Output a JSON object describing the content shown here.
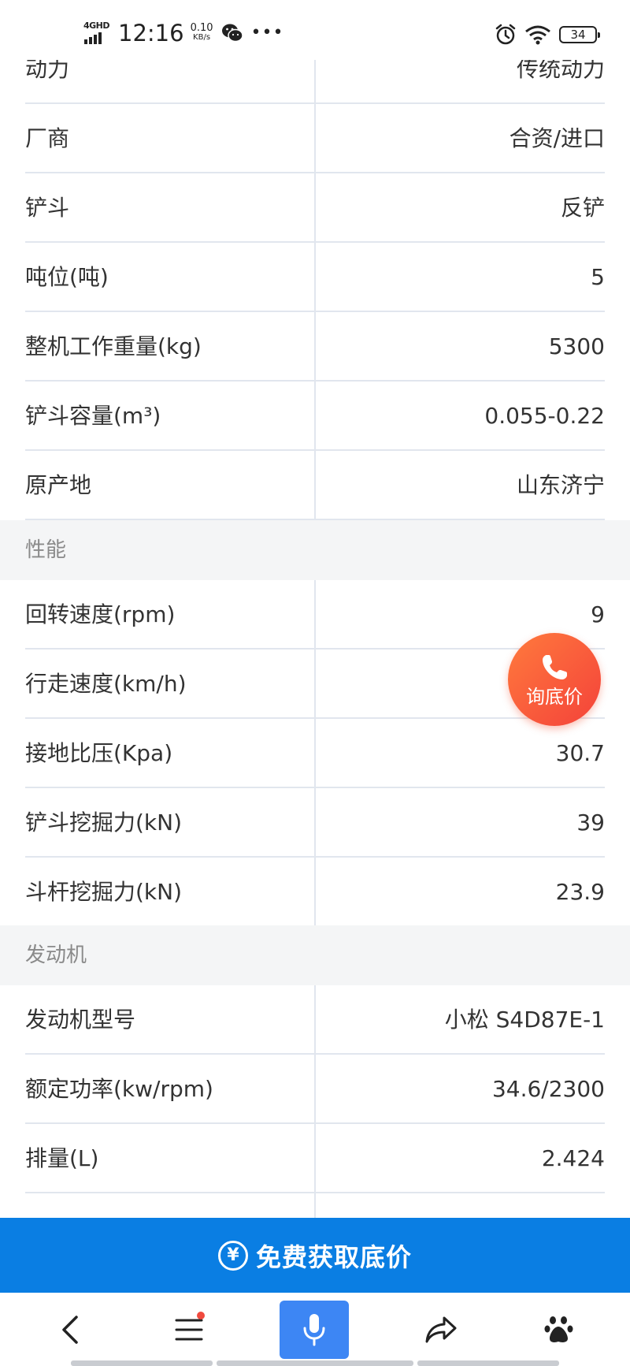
{
  "status_bar": {
    "network": "4GHD",
    "time": "12:16",
    "speed_value": "0.10",
    "speed_unit": "KB/s",
    "more": "•••",
    "battery": "34",
    "icons": [
      "wechat-icon",
      "alarm-icon",
      "wifi-icon",
      "battery-icon"
    ]
  },
  "specs": {
    "rows_group1": [
      {
        "label": "动力",
        "value": "传统动力"
      },
      {
        "label": "厂商",
        "value": "合资/进口"
      },
      {
        "label": "铲斗",
        "value": "反铲"
      },
      {
        "label": "吨位(吨)",
        "value": "5"
      },
      {
        "label": "整机工作重量(kg)",
        "value": "5300"
      },
      {
        "label": "铲斗容量(m³)",
        "value": "0.055-0.22"
      },
      {
        "label": "原产地",
        "value": "山东济宁"
      }
    ],
    "section_performance": "性能",
    "rows_group2": [
      {
        "label": "回转速度(rpm)",
        "value": "9"
      },
      {
        "label": "行走速度(km/h)",
        "value": ""
      },
      {
        "label": "接地比压(Kpa)",
        "value": "30.7"
      },
      {
        "label": "铲斗挖掘力(kN)",
        "value": "39"
      },
      {
        "label": "斗杆挖掘力(kN)",
        "value": "23.9"
      }
    ],
    "section_engine": "发动机",
    "rows_group3": [
      {
        "label": "发动机型号",
        "value": "小松 S4D87E-1"
      },
      {
        "label": "额定功率(kw/rpm)",
        "value": "34.6/2300"
      },
      {
        "label": "排量(L)",
        "value": "2.424"
      }
    ]
  },
  "fab": {
    "label": "询底价",
    "icon": "phone-icon"
  },
  "cta": {
    "label": "免费获取底价",
    "icon_glyph": "¥"
  },
  "nav": {
    "icons": [
      "back-icon",
      "menu-icon",
      "mic-icon",
      "share-icon",
      "paw-icon"
    ]
  },
  "colors": {
    "cta_blue": "#0a7ee3",
    "fab_orange": "#f4583a",
    "mic_blue": "#3d86f4",
    "divider": "#e1e6ee"
  }
}
